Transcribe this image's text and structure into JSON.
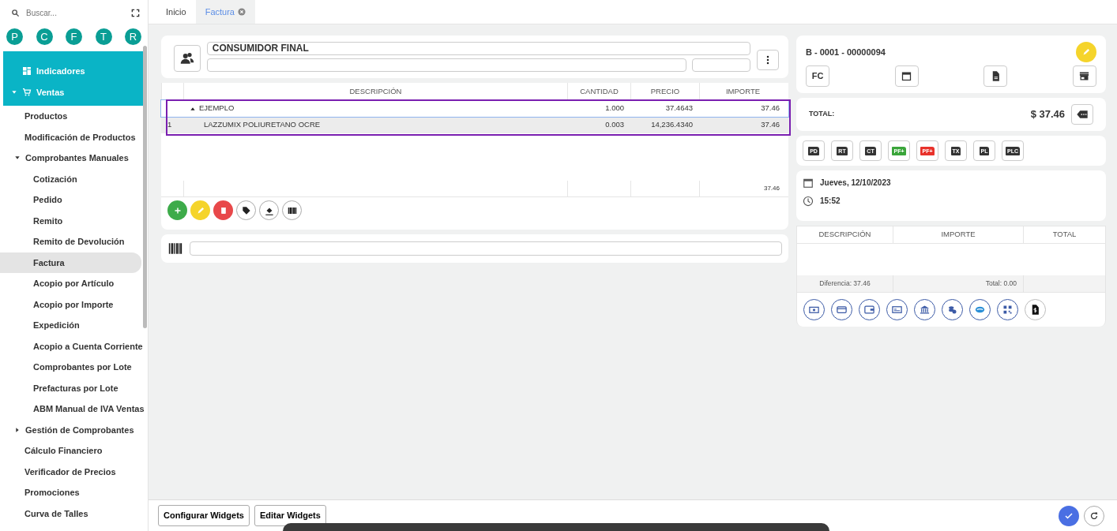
{
  "sidebar": {
    "search": {
      "placeholder": "Buscar..."
    },
    "shortcuts": [
      "P",
      "C",
      "F",
      "T",
      "R"
    ],
    "items": [
      {
        "label": "Indicadores",
        "kind": "link",
        "selected": false
      },
      {
        "label": "Ventas",
        "kind": "group",
        "expanded": true,
        "selected": false,
        "children": [
          {
            "label": "Productos",
            "kind": "link",
            "selected": false
          },
          {
            "label": "Modificación de Productos",
            "kind": "link",
            "selected": false
          },
          {
            "label": "Comprobantes Manuales",
            "kind": "group",
            "expanded": true,
            "selected": false,
            "children": [
              {
                "label": "Cotización",
                "kind": "link",
                "selected": false
              },
              {
                "label": "Pedido",
                "kind": "link",
                "selected": false
              },
              {
                "label": "Remito",
                "kind": "link",
                "selected": false
              },
              {
                "label": "Remito de Devolución",
                "kind": "link",
                "selected": false
              },
              {
                "label": "Factura",
                "kind": "link",
                "selected": true
              },
              {
                "label": "Acopio por Artículo",
                "kind": "link",
                "selected": false
              },
              {
                "label": "Acopio por Importe",
                "kind": "link",
                "selected": false
              },
              {
                "label": "Expedición",
                "kind": "link",
                "selected": false
              },
              {
                "label": "Acopio a Cuenta Corriente",
                "kind": "link",
                "selected": false
              },
              {
                "label": "Comprobantes por Lote",
                "kind": "link",
                "selected": false
              },
              {
                "label": "Prefacturas por Lote",
                "kind": "link",
                "selected": false
              },
              {
                "label": "ABM Manual de IVA Ventas",
                "kind": "link",
                "selected": false
              }
            ]
          },
          {
            "label": "Gestión de Comprobantes",
            "kind": "group",
            "expanded": false,
            "selected": false
          },
          {
            "label": "Cálculo Financiero",
            "kind": "link",
            "selected": false
          },
          {
            "label": "Verificador de Precios",
            "kind": "link",
            "selected": false
          },
          {
            "label": "Promociones",
            "kind": "link",
            "selected": false
          },
          {
            "label": "Curva de Talles",
            "kind": "link",
            "selected": false
          }
        ]
      }
    ]
  },
  "tabs": [
    {
      "label": "Inicio",
      "selected": false,
      "closable": false
    },
    {
      "label": "Factura",
      "selected": true,
      "closable": true
    }
  ],
  "customer": {
    "name": "CONSUMIDOR FINAL"
  },
  "table": {
    "columns": [
      "DESCRIPCIÓN",
      "CANTIDAD",
      "PRECIO",
      "IMPORTE"
    ],
    "rows": [
      {
        "kind": "group",
        "number": "",
        "description": "EJEMPLO",
        "quantity": "1.000",
        "price": "37.4643",
        "amount": "37.46",
        "selected": true
      },
      {
        "kind": "item",
        "number": "1",
        "description": "LAZZUMIX POLIURETANO OCRE",
        "quantity": "0.003",
        "price": "14,236.4340",
        "amount": "37.46",
        "selected": false
      }
    ],
    "footer_amount": "37.46"
  },
  "invoice": {
    "number": "B - 0001 - 00000094",
    "type": "FC",
    "total_label": "TOTAL:",
    "total": "$ 37.46"
  },
  "documents": [
    {
      "label": "PD",
      "color": "#333333"
    },
    {
      "label": "RT",
      "color": "#333333"
    },
    {
      "label": "CT",
      "color": "#333333"
    },
    {
      "label": "PF+",
      "color": "#3aa53a"
    },
    {
      "label": "PF+",
      "color": "#e8322b"
    },
    {
      "label": "TX",
      "color": "#333333"
    },
    {
      "label": "PL",
      "color": "#333333"
    },
    {
      "label": "PLC",
      "color": "#333333"
    }
  ],
  "date": "Jueves, 12/10/2023",
  "time": "15:52",
  "payments": {
    "columns": [
      "DESCRIPCIÓN",
      "IMPORTE",
      "TOTAL"
    ],
    "difference": "Diferencia: 37.46",
    "total": "Total: 0.00"
  },
  "footer": {
    "buttons": [
      "Configurar Widgets",
      "Editar Widgets"
    ]
  }
}
